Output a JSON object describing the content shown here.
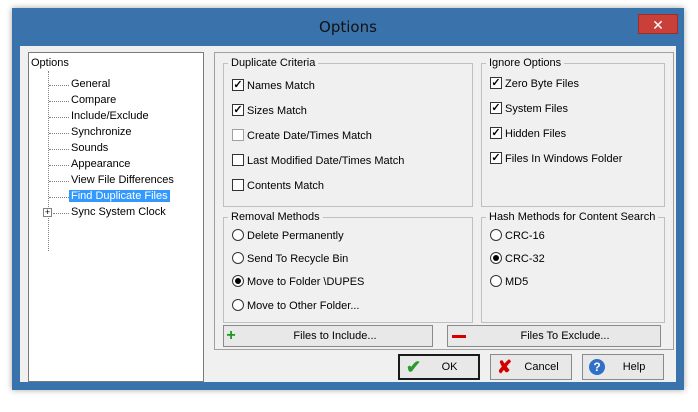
{
  "window": {
    "title": "Options",
    "close_glyph": "✕"
  },
  "tree": {
    "root": "Options",
    "items": [
      "General",
      "Compare",
      "Include/Exclude",
      "Synchronize",
      "Sounds",
      "Appearance",
      "View File Differences",
      "Find Duplicate Files",
      "Sync System Clock"
    ],
    "selected": "Find Duplicate Files",
    "expander_glyph": "+"
  },
  "duplicate_criteria": {
    "title": "Duplicate Criteria",
    "items": [
      {
        "label": "Names Match",
        "checked": true
      },
      {
        "label": "Sizes Match",
        "checked": true
      },
      {
        "label": "Create Date/Times Match",
        "checked": false
      },
      {
        "label": "Last Modified Date/Times Match",
        "checked": false
      },
      {
        "label": "Contents Match",
        "checked": false
      }
    ]
  },
  "ignore_options": {
    "title": "Ignore Options",
    "items": [
      {
        "label": "Zero Byte Files",
        "checked": true
      },
      {
        "label": "System Files",
        "checked": true
      },
      {
        "label": "Hidden Files",
        "checked": true
      },
      {
        "label": "Files In Windows Folder",
        "checked": true
      }
    ]
  },
  "removal_methods": {
    "title": "Removal Methods",
    "items": [
      {
        "label": "Delete Permanently",
        "selected": false
      },
      {
        "label": "Send To Recycle Bin",
        "selected": false
      },
      {
        "label": "Move to Folder \\DUPES",
        "selected": true
      },
      {
        "label": "Move to Other Folder...",
        "selected": false
      }
    ]
  },
  "hash_methods": {
    "title": "Hash Methods for Content Search",
    "items": [
      {
        "label": "CRC-16",
        "selected": false
      },
      {
        "label": "CRC-32",
        "selected": true
      },
      {
        "label": "MD5",
        "selected": false
      }
    ]
  },
  "buttons": {
    "include": "Files to Include...",
    "exclude": "Files To Exclude...",
    "ok": "OK",
    "cancel": "Cancel",
    "help": "Help"
  },
  "icons": {
    "ok": "check-icon",
    "cancel": "x-icon",
    "help": "question-icon",
    "include": "plus-icon",
    "exclude": "minus-icon"
  },
  "colors": {
    "frame": "#3a73ab",
    "close": "#c9403a",
    "selection": "#3399ff",
    "plus": "#1a9a1a",
    "minus": "#d40000"
  }
}
